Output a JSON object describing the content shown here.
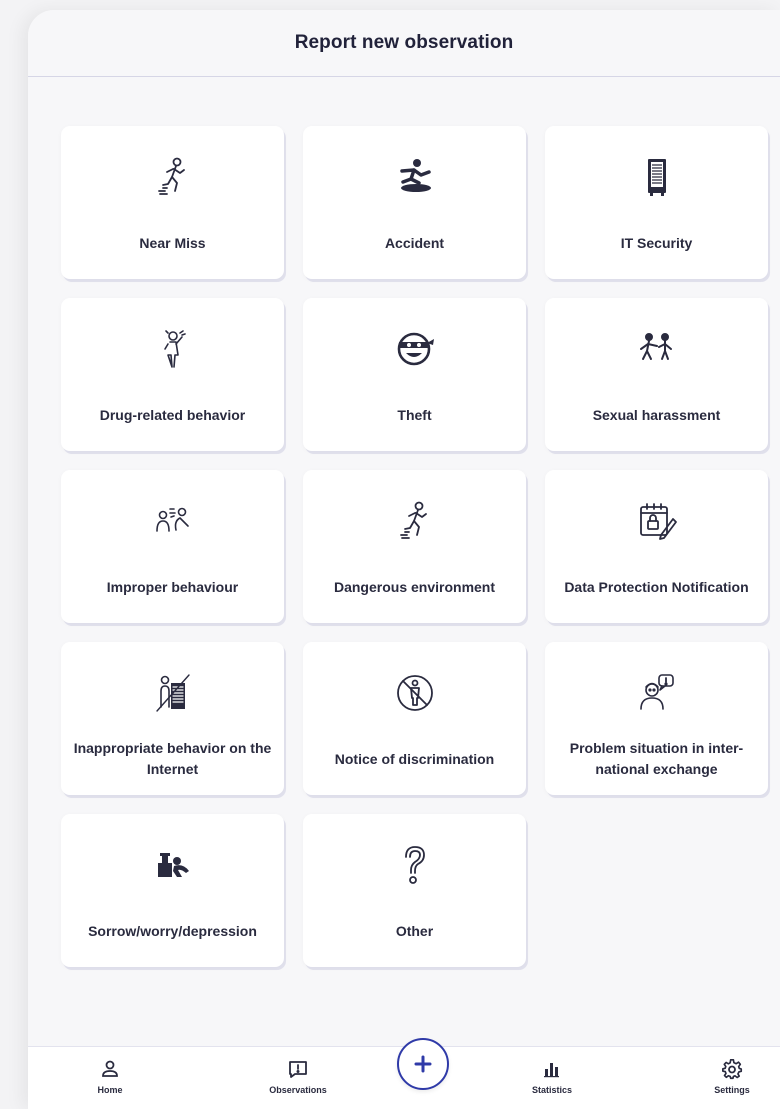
{
  "header": {
    "title": "Report new observation"
  },
  "categories": [
    {
      "label": "Near Miss",
      "icon": "near-miss-icon"
    },
    {
      "label": "Accident",
      "icon": "accident-icon"
    },
    {
      "label": "IT Security",
      "icon": "it-security-icon"
    },
    {
      "label": "Drug-related behavior",
      "icon": "drug-related-icon"
    },
    {
      "label": "Theft",
      "icon": "theft-icon"
    },
    {
      "label": "Sexual harassment",
      "icon": "sexual-harassment-icon"
    },
    {
      "label": "Improper behaviour",
      "icon": "improper-behaviour-icon"
    },
    {
      "label": "Dangerous environment",
      "icon": "dangerous-environment-icon"
    },
    {
      "label": "Data Protection Notification",
      "icon": "data-protection-icon"
    },
    {
      "label": "Inappropriate behavior on the Internet",
      "icon": "inappropriate-internet-icon"
    },
    {
      "label": "Notice of discrimination",
      "icon": "discrimination-icon"
    },
    {
      "label": "Problem situation in inter-national exchange",
      "icon": "international-exchange-icon"
    },
    {
      "label": "Sorrow/worry/depression",
      "icon": "sorrow-icon"
    },
    {
      "label": "Other",
      "icon": "question-icon"
    }
  ],
  "nav": {
    "home": "Home",
    "observations": "Observations",
    "statistics": "Statistics",
    "settings": "Settings",
    "fab_icon": "plus-icon"
  },
  "colors": {
    "accent": "#2f3aa8",
    "background": "#f7f7f9",
    "card": "#ffffff",
    "text": "#1f2033"
  }
}
